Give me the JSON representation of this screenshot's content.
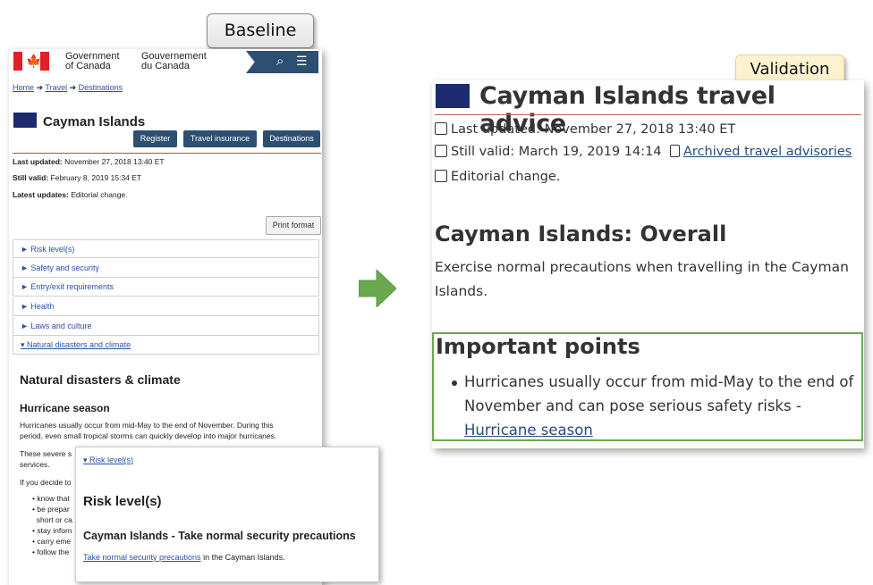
{
  "labels": {
    "baseline": "Baseline",
    "validation": "Validation"
  },
  "baseline": {
    "gov_en": [
      "Government",
      "of Canada"
    ],
    "gov_fr": [
      "Gouvernement",
      "du Canada"
    ],
    "breadcrumb": [
      "Home",
      "Travel",
      "Destinations"
    ],
    "country": "Cayman Islands",
    "buttons": [
      "Register",
      "Travel insurance",
      "Destinations"
    ],
    "last_updated_label": "Last updated:",
    "last_updated": "November 27, 2018 13:40 ET",
    "still_valid_label": "Still valid:",
    "still_valid": "February 8, 2019 15:34 ET",
    "latest_updates_label": "Latest updates:",
    "latest_updates": "Editorial change.",
    "print": "Print format",
    "accordion": [
      "► Risk level(s)",
      "► Safety and security",
      "► Entry/exit requirements",
      "► Health",
      "► Laws and culture",
      "▾ Natural disasters and climate"
    ],
    "section_title": "Natural disasters & climate",
    "subsection": "Hurricane season",
    "para1": [
      "Hurricanes usually occur from mid-May to the end of November. During this",
      "period, even small tropical storms can quickly develop into major hurricanes."
    ],
    "para2": [
      "These severe s",
      "services."
    ],
    "para3": "If you decide to",
    "list": [
      "know that",
      "be prepar",
      "short or ca",
      "stay inforn",
      "carry eme",
      "follow the"
    ]
  },
  "popup": {
    "risk_link": "▾ Risk level(s)",
    "heading": "Risk level(s)",
    "subheading": "Cayman Islands - Take normal security precautions",
    "text_link": "Take normal security precautions",
    "text_rest": " in the Cayman Islands."
  },
  "validation": {
    "title": "Cayman Islands travel advice",
    "last_updated": "Last updated: November 27, 2018 13:40 ET",
    "still_valid": "Still valid: March 19, 2019 14:14",
    "archived": "Archived travel advisories",
    "editorial": "Editorial change.",
    "overall_heading": "Cayman Islands: Overall",
    "overall_text": "Exercise normal precautions when travelling in the Cayman Islands.",
    "important_heading": "Important points",
    "bullet_text": "Hurricanes usually occur from mid-May to the end of November and can pose serious safety risks - ",
    "bullet_link": "Hurricane season"
  },
  "colors": {
    "accent_dark_blue": "#2c4f72",
    "highlight_green": "#6aa84f",
    "arrow_green": "#6aa84f",
    "validation_label_bg": "#fdf2cf"
  }
}
